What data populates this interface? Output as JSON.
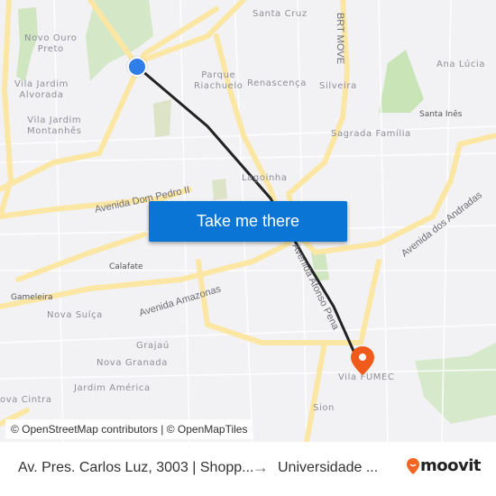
{
  "map": {
    "neighborhoods": [
      {
        "id": "novo-ouro-preto",
        "text": "Novo Ouro\nPreto"
      },
      {
        "id": "vila-jardim-alvorada",
        "text": "Vila Jardim\nAlvorada"
      },
      {
        "id": "vila-jardim-montanhes",
        "text": "Vila Jardim\nMontanhês"
      },
      {
        "id": "santa-cruz",
        "text": "Santa Cruz"
      },
      {
        "id": "parque-riachuelo",
        "text": "Parque\nRiachuelo"
      },
      {
        "id": "renascenca",
        "text": "Renascença"
      },
      {
        "id": "silveira",
        "text": "Silveira"
      },
      {
        "id": "ana-lucia",
        "text": "Ana Lúcia"
      },
      {
        "id": "santa-ines",
        "text": "Santa Inês"
      },
      {
        "id": "sagrada-familia",
        "text": "Sagrada Família"
      },
      {
        "id": "lagoinha",
        "text": "Lagoinha"
      },
      {
        "id": "calafate",
        "text": "Calafate"
      },
      {
        "id": "gameleira",
        "text": "Gameleira"
      },
      {
        "id": "nova-suica",
        "text": "Nova Suíça"
      },
      {
        "id": "grajau",
        "text": "Grajaú"
      },
      {
        "id": "nova-granada",
        "text": "Nova Granada"
      },
      {
        "id": "jardim-america",
        "text": "Jardim América"
      },
      {
        "id": "nova-cintra",
        "text": "ova Cintra"
      },
      {
        "id": "vila-fumec",
        "text": "Vila FUMEC"
      },
      {
        "id": "sion",
        "text": "Sion"
      }
    ],
    "streets": [
      {
        "id": "brt-move",
        "text": "BRT MOVE"
      },
      {
        "id": "avenida-dom-pedro-ii",
        "text": "Avenida Dom Pedro II"
      },
      {
        "id": "avenida-amazonas",
        "text": "Avenida Amazonas"
      },
      {
        "id": "avenida-afonso-pena",
        "text": "Avenida Afonso Pena"
      },
      {
        "id": "avenida-dos-andradas",
        "text": "Avenida dos Andradas"
      }
    ],
    "attribution": "© OpenStreetMap contributors | © OpenMapTiles",
    "origin_marker_color": "#2f7de8",
    "destination_marker_color": "#f05a1a",
    "route_color": "#222222"
  },
  "cta": {
    "label": "Take me there",
    "color": "#0a75d5"
  },
  "footer": {
    "from": "Av. Pres. Carlos Luz, 3003 | Shopp...",
    "arrow": "→",
    "to": "Universidade ...",
    "brand": "moovit",
    "brand_color": "#f26522"
  }
}
